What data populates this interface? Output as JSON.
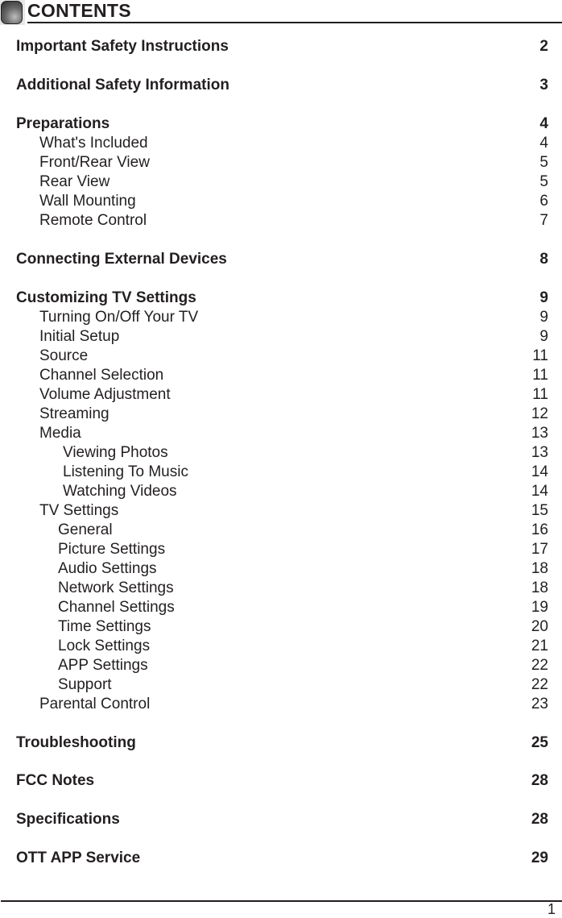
{
  "header": {
    "title": "CONTENTS",
    "icon": "rounded-square-bullet-icon"
  },
  "entries": [
    {
      "label": "Important Safety Instructions",
      "page": "2",
      "level": 0
    },
    {
      "label": "Additional Safety Information",
      "page": "3",
      "level": 0
    },
    {
      "label": "Preparations",
      "page": "4",
      "level": 0
    },
    {
      "label": "What's Included",
      "page": "4",
      "level": 1
    },
    {
      "label": "Front/Rear View",
      "page": "5",
      "level": 1
    },
    {
      "label": "Rear View",
      "page": "5",
      "level": 1
    },
    {
      "label": "Wall Mounting",
      "page": "6",
      "level": 1
    },
    {
      "label": "Remote Control",
      "page": "7",
      "level": 1
    },
    {
      "label": "Connecting External Devices",
      "page": "8",
      "level": 0
    },
    {
      "label": "Customizing TV Settings",
      "page": "9",
      "level": 0
    },
    {
      "label": "Turning On/Off Your TV",
      "page": "9",
      "level": 1
    },
    {
      "label": "Initial Setup",
      "page": "9",
      "level": 1
    },
    {
      "label": "Source",
      "page": "11",
      "level": 1
    },
    {
      "label": "Channel Selection",
      "page": "11",
      "level": 1
    },
    {
      "label": "Volume Adjustment",
      "page": "11",
      "level": 1
    },
    {
      "label": "Streaming",
      "page": "12",
      "level": 1
    },
    {
      "label": "Media",
      "page": "13",
      "level": 1
    },
    {
      "label": "Viewing Photos",
      "page": "13",
      "level": 2
    },
    {
      "label": "Listening To Music",
      "page": "14",
      "level": 2
    },
    {
      "label": "Watching Videos",
      "page": "14",
      "level": 2
    },
    {
      "label": "TV Settings",
      "page": "15",
      "level": 1
    },
    {
      "label": "General",
      "page": "16",
      "level": 3
    },
    {
      "label": "Picture Settings",
      "page": "17",
      "level": 3
    },
    {
      "label": "Audio Settings",
      "page": "18",
      "level": 3
    },
    {
      "label": "Network Settings",
      "page": "18",
      "level": 3
    },
    {
      "label": "Channel Settings",
      "page": "19",
      "level": 3
    },
    {
      "label": "Time Settings",
      "page": "20",
      "level": 3
    },
    {
      "label": "Lock Settings",
      "page": "21",
      "level": 3
    },
    {
      "label": "APP Settings",
      "page": "22",
      "level": 3
    },
    {
      "label": "Support",
      "page": "22",
      "level": 3
    },
    {
      "label": "Parental Control",
      "page": "23",
      "level": 1
    },
    {
      "label": "Troubleshooting",
      "page": "25",
      "level": 0
    },
    {
      "label": "FCC  Notes",
      "page": "28",
      "level": 0
    },
    {
      "label": "Specifications",
      "page": "28",
      "level": 0
    },
    {
      "label": "OTT APP Service",
      "page": "29",
      "level": 0
    }
  ],
  "footer": {
    "page_number": "1"
  }
}
